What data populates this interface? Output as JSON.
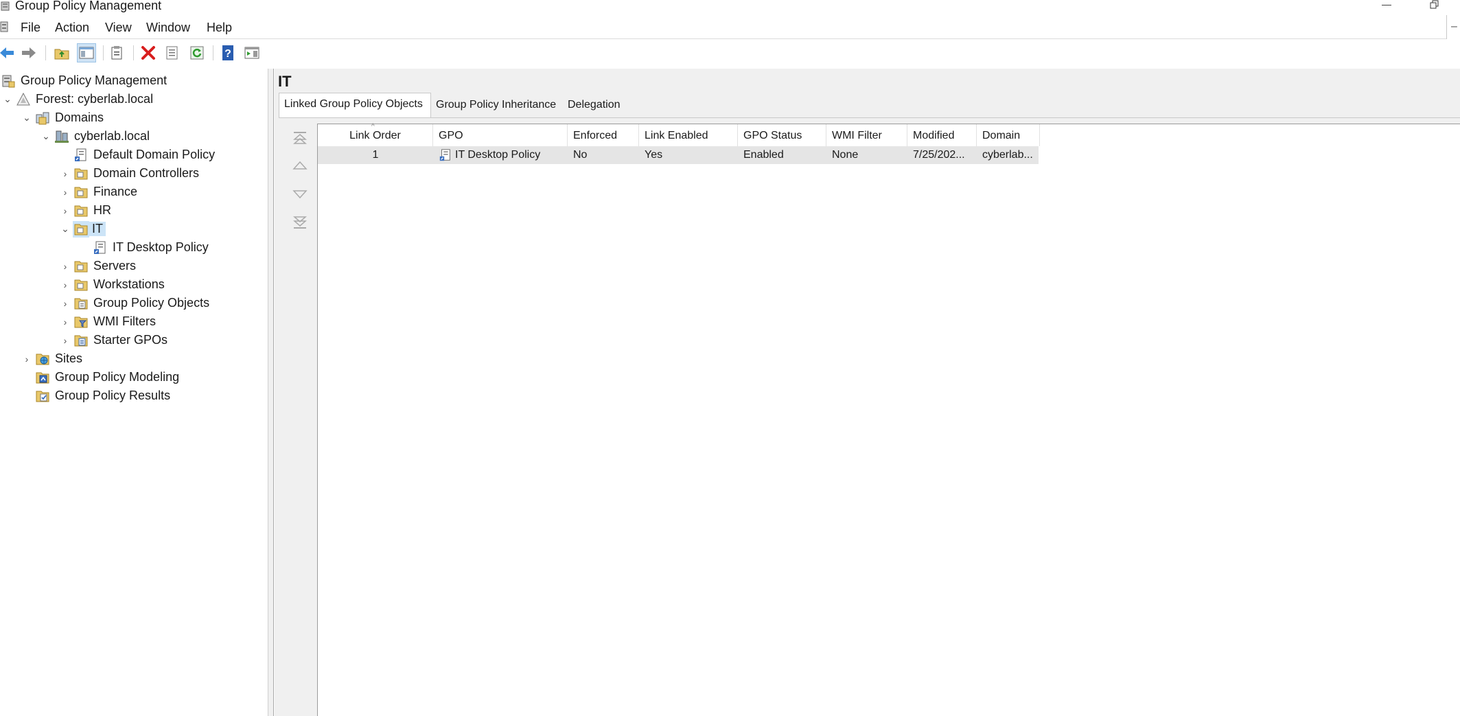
{
  "window": {
    "title": "Group Policy Management"
  },
  "menubar": {
    "items": [
      "File",
      "Action",
      "View",
      "Window",
      "Help"
    ],
    "right_glyph": "–"
  },
  "toolbar": {
    "icons": [
      "back-icon",
      "forward-icon",
      "up-folder-icon",
      "show-hide-tree-icon",
      "properties-icon",
      "delete-icon",
      "export-list-icon",
      "refresh-icon",
      "help-icon",
      "show-action-pane-icon"
    ]
  },
  "tree": {
    "items": [
      {
        "label": "Group Policy Management",
        "icon": "gpm-icon"
      },
      {
        "label": "Forest: cyberlab.local",
        "icon": "forest-icon"
      },
      {
        "label": "Domains",
        "icon": "domains-icon"
      },
      {
        "label": "cyberlab.local",
        "icon": "domain-icon"
      },
      {
        "label": "Default Domain Policy",
        "icon": "gpo-link-icon"
      },
      {
        "label": "Domain Controllers",
        "icon": "ou-folder-icon"
      },
      {
        "label": "Finance",
        "icon": "ou-folder-icon"
      },
      {
        "label": "HR",
        "icon": "ou-folder-icon"
      },
      {
        "label": "IT",
        "icon": "ou-folder-icon"
      },
      {
        "label": "IT Desktop Policy",
        "icon": "gpo-link-icon"
      },
      {
        "label": "Servers",
        "icon": "ou-folder-icon"
      },
      {
        "label": "Workstations",
        "icon": "ou-folder-icon"
      },
      {
        "label": "Group Policy Objects",
        "icon": "gpo-container-icon"
      },
      {
        "label": "WMI Filters",
        "icon": "wmi-filter-icon"
      },
      {
        "label": "Starter GPOs",
        "icon": "starter-gpo-icon"
      },
      {
        "label": "Sites",
        "icon": "sites-icon"
      },
      {
        "label": "Group Policy Modeling",
        "icon": "modeling-icon"
      },
      {
        "label": "Group Policy Results",
        "icon": "results-icon"
      }
    ]
  },
  "right_pane": {
    "title": "IT",
    "tabs": [
      "Linked Group Policy Objects",
      "Group Policy Inheritance",
      "Delegation"
    ],
    "active_tab": "Linked Group Policy Objects",
    "columns": [
      "Link Order",
      "GPO",
      "Enforced",
      "Link Enabled",
      "GPO Status",
      "WMI Filter",
      "Modified",
      "Domain"
    ],
    "rows": [
      {
        "link_order": "1",
        "gpo": "IT Desktop Policy",
        "enforced": "No",
        "link_enabled": "Yes",
        "gpo_status": "Enabled",
        "wmi_filter": "None",
        "modified": "7/25/202...",
        "domain": "cyberlab..."
      }
    ]
  },
  "colors": {
    "selection": "#cce4f7",
    "pane_bg": "#f0f0f0",
    "row_bg": "#e5e5e5",
    "delete_red": "#d81e1e",
    "help_blue": "#2a5db0",
    "folder_yellow": "#e9c86a"
  }
}
